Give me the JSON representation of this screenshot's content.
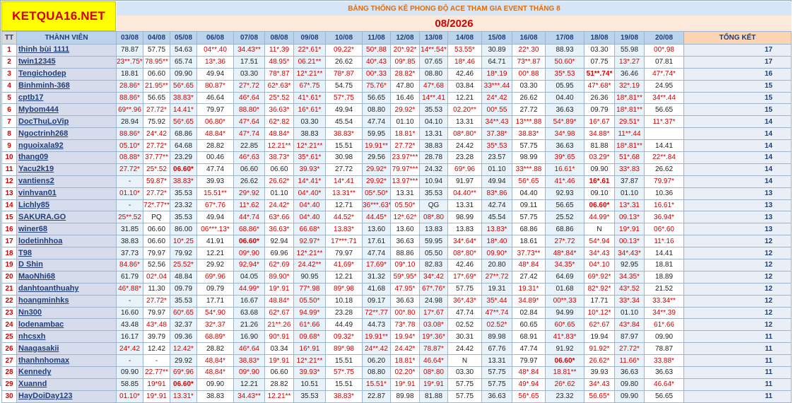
{
  "header": {
    "logo": "KETQUA16.NET",
    "title": "BẢNG THỐNG KÊ PHONG ĐỘ ACE THAM GIA EVENT THÁNG 8",
    "month": "08/2026"
  },
  "columns": {
    "tt": "TT",
    "member": "THÀNH VIÊN",
    "dates": [
      "03/08",
      "04/08",
      "05/08",
      "06/08",
      "07/08",
      "08/08",
      "09/08",
      "10/08",
      "11/08",
      "12/08",
      "13/08",
      "14/08",
      "15/08",
      "16/08",
      "17/08",
      "18/08",
      "19/08",
      "20/08"
    ],
    "total": "TỔNG KẾT"
  },
  "colors": {
    "red": "#d40000",
    "navy": "#1f3d7a",
    "logo_bg": "#ffff00",
    "title_orange": "#e26b0a"
  },
  "rows": [
    {
      "tt": "1",
      "name": "thinh bùi 1111",
      "cells": [
        "78.87",
        "57.75",
        "54.63",
        "04**.40",
        "34.43**",
        "11*.39",
        "22*.61*",
        "09.22*",
        "50*.88",
        "20*.92*",
        "14**.54*",
        "53.55*",
        "30.89",
        "22*.30",
        "88.93",
        "03.30",
        "55.98",
        "00*.98"
      ],
      "total": "17"
    },
    {
      "tt": "2",
      "name": "twin12345",
      "cells": [
        "23**.75**",
        "78.95**",
        "65.74",
        "13*.36",
        "17.51",
        "48.95*",
        "06.21**",
        "26.62",
        "40*.43",
        "09*.85",
        "07.65",
        "18*.46",
        "64.71",
        "73**.87",
        "50.60*",
        "07.75",
        "13*.27",
        "07.81"
      ],
      "total": "17"
    },
    {
      "tt": "3",
      "name": "Tengichodep",
      "cells": [
        "18.81",
        "06.60",
        "09.90",
        "49.94",
        "03.30",
        "78*.87",
        "12*.21**",
        "78*.87",
        "00*.33",
        "28.82*",
        "08.80",
        "42.46",
        "18*.19",
        "00*.88",
        "35*.53",
        "51**.74*",
        "36.46",
        "47*.74*"
      ],
      "total": "16"
    },
    {
      "tt": "4",
      "name": "Binhminh-368",
      "cells": [
        "28.86*",
        "21.95**",
        "56*.65",
        "80.87*",
        "27*.72",
        "62*.63*",
        "67*.75",
        "54.75",
        "75.76*",
        "47.80",
        "47*.68",
        "03.84",
        "33***.44",
        "03.30",
        "05.95",
        "47*.68*",
        "32*.19",
        "24.95"
      ],
      "total": "15"
    },
    {
      "tt": "5",
      "name": "cptb17",
      "cells": [
        "88.86*",
        "56.65",
        "38.83*",
        "46.64",
        "46*.64",
        "25*.52",
        "41*.61*",
        "57*.75",
        "56.65",
        "16.46",
        "14**.41",
        "12.21",
        "24*.42",
        "26.62",
        "04.40",
        "26.36",
        "18*.81**",
        "34**.44"
      ],
      "total": "15"
    },
    {
      "tt": "6",
      "name": "Mybom444",
      "cells": [
        "69**.96",
        "27.72*",
        "14.41*",
        "79.97",
        "88.80*",
        "36.63*",
        "16*.61*",
        "49.94",
        "08.80",
        "29.92*",
        "35.53",
        "02.20**",
        "00*.55",
        "27.72",
        "36.63",
        "09.79",
        "18*.81**",
        "56.65"
      ],
      "total": "15"
    },
    {
      "tt": "7",
      "name": "DocThuLoVip",
      "cells": [
        "28.94",
        "75.92",
        "56*.65",
        "06.80*",
        "47*.64",
        "62*.82",
        "03.30",
        "45.54",
        "47.74",
        "01.10",
        "04.10",
        "13.31",
        "34**.43",
        "13***.88",
        "54*.89*",
        "16*.67",
        "29.51*",
        "11*.37*"
      ],
      "total": "14"
    },
    {
      "tt": "8",
      "name": "Ngoctrinh268",
      "cells": [
        "88.86*",
        "24*.42",
        "68.86",
        "48.84*",
        "47*.74",
        "48.84*",
        "38.83",
        "38.83*",
        "59.95",
        "18.81*",
        "13.31",
        "08*.80*",
        "37.38*",
        "38.83*",
        "34*.98",
        "34.88*",
        "11**.44"
      ],
      "total": "14"
    },
    {
      "tt": "9",
      "name": "nguoixala92",
      "cells": [
        "05.10*",
        "27.72*",
        "64.68",
        "28.82",
        "22.85",
        "12.21**",
        "12*.21**",
        "15.51",
        "19.91**",
        "27.72*",
        "38.83",
        "24.42",
        "35*.53",
        "57.75",
        "36.63",
        "81.88",
        "18*.81**",
        "14.41"
      ],
      "total": "14"
    },
    {
      "tt": "10",
      "name": "thang09",
      "cells": [
        "08.88*",
        "37.77**",
        "23.29",
        "00.46",
        "46*.63",
        "38.73*",
        "35*.61*",
        "30.98",
        "29.56",
        "23.97***",
        "28.78",
        "23.28",
        "23.57",
        "98.99",
        "39*.65",
        "03.29*",
        "51*.68",
        "22**.84"
      ],
      "total": "14"
    },
    {
      "tt": "11",
      "name": "Yacu2k19",
      "cells": [
        "27.72*",
        "25*.52",
        "06.60*",
        "47.74",
        "06.60",
        "06.60",
        "39.93*",
        "27.72",
        "29.92*",
        "79.97***",
        "24.32",
        "69*.96",
        "01.10",
        "33***.88",
        "16.61*",
        "09.90",
        "33*.83",
        "26.62"
      ],
      "total": "14"
    },
    {
      "tt": "12",
      "name": "vantiens2",
      "cells": [
        "-",
        "59.87*",
        "38.83*",
        "39.93",
        "26.62",
        "26.62*",
        "14*.41*",
        "14*.41",
        "29.92*",
        "13.97***",
        "10.94",
        "91.97",
        "49.94",
        "56*.65",
        "41*.46",
        "16*.61",
        "37.87",
        "79.97*"
      ],
      "total": "14"
    },
    {
      "tt": "13",
      "name": "vinhvan01",
      "cells": [
        "01.10*",
        "27.72*",
        "35.53",
        "15.51**",
        "29*.92",
        "01.10",
        "04*.40*",
        "13.31**",
        "05*.50*",
        "13.31",
        "35.53",
        "04.40**",
        "83*.86",
        "04.40",
        "92.93",
        "09.10",
        "01.10",
        "10.36"
      ],
      "total": "13"
    },
    {
      "tt": "14",
      "name": "Lichly85",
      "cells": [
        "-",
        "72*.77**",
        "23.32",
        "67*.76",
        "11*.62",
        "24.42*",
        "04*.40",
        "12.71",
        "36***.63*",
        "05.50*",
        "QG",
        "13.31",
        "42.74",
        "09.11",
        "56.65",
        "06.60*",
        "13*.31",
        "16.61*"
      ],
      "total": "13"
    },
    {
      "tt": "15",
      "name": "SAKURA.GO",
      "cells": [
        "25**.52",
        "PQ",
        "35.53",
        "49.94",
        "44*.74",
        "63*.66",
        "04*.40",
        "44.52*",
        "44.45*",
        "12*.62*",
        "08*.80",
        "98.99",
        "45.54",
        "57.75",
        "25.52",
        "44.99*",
        "09.13*",
        "36.94*"
      ],
      "total": "13"
    },
    {
      "tt": "16",
      "name": "winer68",
      "cells": [
        "31.85",
        "06.60",
        "86.00",
        "06***.13*",
        "68.86*",
        "36.63*",
        "66.68*",
        "13.83*",
        "13.60",
        "13.60",
        "13.83",
        "13.83",
        "13.83*",
        "68.86",
        "68.86",
        "N",
        "19*.91",
        "06*.60"
      ],
      "total": "13"
    },
    {
      "tt": "17",
      "name": "lodetinhhoa",
      "cells": [
        "38.83",
        "06.60",
        "10*.25",
        "41.91",
        "06.60*",
        "92.94",
        "92.97*",
        "17***.71",
        "17.61",
        "36.63",
        "59.95",
        "34*.64*",
        "18*.40",
        "18.61",
        "27*.72",
        "54*.94",
        "00.13*",
        "11*.16"
      ],
      "total": "12"
    },
    {
      "tt": "18",
      "name": "T98",
      "cells": [
        "37.73",
        "79.97",
        "79.92",
        "12.21",
        "09*.90",
        "69.96",
        "12*.21**",
        "79.97",
        "47.74",
        "88.86",
        "05.50",
        "08*.80*",
        "09.90*",
        "37.73**",
        "48*.84*",
        "34*.43",
        "34*.43*",
        "14.41"
      ],
      "total": "12"
    },
    {
      "tt": "19",
      "name": "D Shin",
      "cells": [
        "84.86*",
        "52.56",
        "25.52*",
        "29.92",
        "92.94*",
        "62*.69",
        "24.42**",
        "41.69*",
        "17.69*",
        "09*.10",
        "82.83",
        "42.46",
        "20.80",
        "48*.84",
        "34.35*",
        "04*.10",
        "92.95",
        "18.81"
      ],
      "total": "12"
    },
    {
      "tt": "20",
      "name": "MaoNhi68",
      "cells": [
        "61.79",
        "02*.04",
        "48.84",
        "69*.96",
        "04.05",
        "89.90*",
        "90.95",
        "12.21",
        "31.32",
        "59*.95*",
        "34*.42",
        "17*.69*",
        "27**.72",
        "27.42",
        "64.69",
        "69*.92*",
        "34.35*",
        "18.89"
      ],
      "total": "12"
    },
    {
      "tt": "21",
      "name": "danhtoanthuahy",
      "cells": [
        "46*.88*",
        "11.30",
        "09.79",
        "09.79",
        "44.99*",
        "19*.91",
        "77*.98",
        "89*.98",
        "41.68",
        "47.95*",
        "67*.76*",
        "57.75",
        "19.31",
        "19.31*",
        "01.68",
        "82*.92*",
        "43*.52",
        "21.52"
      ],
      "total": "12"
    },
    {
      "tt": "22",
      "name": "hoangminhks",
      "cells": [
        "-",
        "27.72*",
        "35.53",
        "17.71",
        "16.67",
        "48.84*",
        "05.50*",
        "10.18",
        "09.17",
        "36.63",
        "24.98",
        "36*.43*",
        "35*.44",
        "34.89*",
        "00**.33",
        "17.71",
        "33*.34",
        "33.34**"
      ],
      "total": "12"
    },
    {
      "tt": "23",
      "name": "Nn300",
      "cells": [
        "16.60",
        "79.97",
        "60*.65",
        "54*.90",
        "63.68",
        "62*.67",
        "94.99*",
        "23.28",
        "72**.77",
        "00*.80",
        "17*.67",
        "47.74",
        "47**.74",
        "02.84",
        "94.99",
        "10*.12*",
        "01.10",
        "34**.39"
      ],
      "total": "12"
    },
    {
      "tt": "24",
      "name": "lodenambac",
      "cells": [
        "43.48",
        "43*.48",
        "32.37",
        "32*.37",
        "21.26",
        "21**.26",
        "61*.66",
        "44.49",
        "44.73",
        "73*.78",
        "03.08*",
        "02.52",
        "02.52*",
        "60.65",
        "60*.65",
        "62*.67",
        "43*.84",
        "61*.66"
      ],
      "total": "12"
    },
    {
      "tt": "25",
      "name": "nhcsxh",
      "cells": [
        "16.17",
        "39.79",
        "09.36",
        "68.89*",
        "16.90",
        "90*.91",
        "09.68*",
        "09.32*",
        "19.91**",
        "19.94*",
        "19*.36*",
        "30.31",
        "89.98",
        "68.91",
        "41*.83*",
        "19.94",
        "87.97",
        "09.90"
      ],
      "total": "11"
    },
    {
      "tt": "26",
      "name": "Naagasakii",
      "cells": [
        "24*.42",
        "12.42",
        "12.42*",
        "28.82",
        "46*.64",
        "03.34",
        "16*.91",
        "89*.98",
        "24**.42",
        "24.42*",
        "78.87*",
        "24.42",
        "67.76",
        "47.74",
        "91.92",
        "91.92*",
        "27.72*",
        "78.87"
      ],
      "total": "11"
    },
    {
      "tt": "27",
      "name": "thanhnhomax",
      "cells": [
        "-",
        "-",
        "29.92",
        "48.84*",
        "38.83*",
        "19*.91",
        "12*.21**",
        "15.51",
        "06.20",
        "18.81*",
        "46.64*",
        "N",
        "13.31",
        "79.97",
        "06.60*",
        "26.62*",
        "11.66*",
        "33.88*"
      ],
      "total": "11"
    },
    {
      "tt": "28",
      "name": "Kennedy",
      "cells": [
        "09.90",
        "22.77**",
        "69*.96",
        "48.84*",
        "09*.90",
        "06.60",
        "39.93*",
        "57*.75",
        "08.80",
        "02.20*",
        "08*.80",
        "03.30",
        "57.75",
        "48*.84",
        "18.81**",
        "39.93",
        "36.63",
        "36.63"
      ],
      "total": "11"
    },
    {
      "tt": "29",
      "name": "Xuannd",
      "cells": [
        "58.85",
        "19*91",
        "06.60*",
        "09.90",
        "12.21",
        "28.82",
        "10.51",
        "15.51",
        "15.51*",
        "19*.91",
        "19*.91",
        "57.75",
        "57.75",
        "49*.94",
        "26*.62",
        "34*.43",
        "09.80",
        "46.64*"
      ],
      "total": "11"
    },
    {
      "tt": "30",
      "name": "HayDoiDay123",
      "cells": [
        "01.10*",
        "19*.91",
        "13.31*",
        "38.83",
        "34.43**",
        "12.21**",
        "35.53",
        "38.83*",
        "22.87",
        "89.98",
        "81.88",
        "57.75",
        "36.63",
        "56*.65",
        "23.32",
        "56.65*",
        "09.90",
        "56.65"
      ],
      "total": "11"
    }
  ]
}
